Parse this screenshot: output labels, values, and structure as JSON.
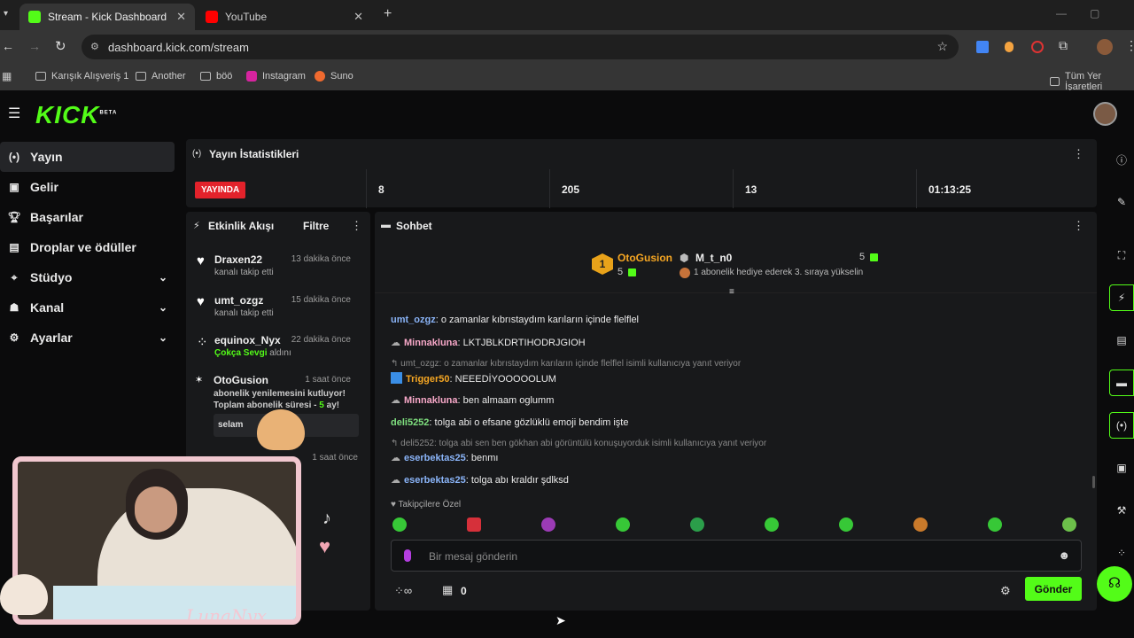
{
  "browser": {
    "tabs": [
      {
        "title": "Stream - Kick Dashboard",
        "active": true
      },
      {
        "title": "YouTube",
        "active": false
      }
    ],
    "url": "dashboard.kick.com/stream",
    "bookmarks": [
      "Karışık Alışveriş 1",
      "Another",
      "böö",
      "Instagram",
      "Suno"
    ],
    "bookmarks_right": "Tüm Yer İşaretleri"
  },
  "app": {
    "logo": "KICK",
    "logo_badge": "BETA"
  },
  "sidebar": {
    "items": [
      {
        "label": "Yayın",
        "icon": "broadcast-icon"
      },
      {
        "label": "Gelir",
        "icon": "revenue-icon"
      },
      {
        "label": "Başarılar",
        "icon": "trophy-icon"
      },
      {
        "label": "Droplar ve ödüller",
        "icon": "gift-icon"
      },
      {
        "label": "Stüdyo",
        "icon": "studio-icon"
      },
      {
        "label": "Kanal",
        "icon": "channel-icon"
      },
      {
        "label": "Ayarlar",
        "icon": "gear-icon"
      }
    ]
  },
  "stats": {
    "title": "Yayın İstatistikleri",
    "live_label": "YAYINDA",
    "values": [
      "8",
      "205",
      "13",
      "01:13:25"
    ]
  },
  "activity": {
    "title": "Etkinlik Akışı",
    "filter": "Filtre",
    "events": [
      {
        "name": "Draxen22",
        "time": "13 dakika önce",
        "text": "kanalı takip etti"
      },
      {
        "name": "umt_ozgz",
        "time": "15 dakika önce",
        "text": "kanalı takip etti"
      },
      {
        "name": "equinox_Nyx",
        "time": "22 dakika önce",
        "text_strong": "Çokça Sevgi",
        "text": "aldını"
      },
      {
        "name": "OtoGusion",
        "time": "1 saat önce",
        "text": "abonelik yenilemesini kutluyor! Toplam abonelik süresi -",
        "months": "5",
        "months_suffix": "ay!",
        "reply": "selam"
      }
    ],
    "extra_time": "1 saat önce"
  },
  "chat": {
    "title": "Sohbet",
    "pinned": {
      "rank": "1",
      "user1": "OtoGusion",
      "user1_count": "5",
      "user2": "M_t_n0",
      "user2_count": "5",
      "info": "1 abonelik hediye ederek 3. sıraya yükselin"
    },
    "messages": [
      {
        "type": "msg",
        "user": "umt_ozgz",
        "color": "blue",
        "text": "o zamanlar kıbrıstaydım karıların içinde flelflel"
      },
      {
        "type": "msg",
        "user": "Minnakluna",
        "color": "pink",
        "text": "LKTJBLKDRTIHODRJGIOH"
      },
      {
        "type": "reply",
        "text": "umt_ozgz: o zamanlar kıbrıstaydım karıların içinde flelflel isimli kullanıcıya yanıt veriyor"
      },
      {
        "type": "msg",
        "user": "Trigger50",
        "color": "orange",
        "text": "NEEEDİYOOOOOLUM"
      },
      {
        "type": "msg",
        "user": "Minnakluna",
        "color": "pink",
        "text": "ben almaam oglumm"
      },
      {
        "type": "msg",
        "user": "deli5252",
        "color": "green",
        "text": "tolga abi o efsane gözlüklü emoji bendim işte"
      },
      {
        "type": "reply",
        "text": "deli5252: tolga abi sen ben gökhan abi görüntülü konuşuyorduk isimli kullanıcıya yanıt veriyor"
      },
      {
        "type": "msg",
        "user": "eserbektas25",
        "color": "blue",
        "text": "benmı"
      },
      {
        "type": "msg",
        "user": "eserbektas25",
        "color": "blue",
        "text": "tolga abı kraldır şdlksd"
      }
    ],
    "followers_only": "Takipçilere Özel",
    "input_placeholder": "Bir mesaj gönderin",
    "points_count": "0",
    "send_label": "Gönder"
  },
  "overlay": {
    "watermark": "LunaNyx"
  }
}
